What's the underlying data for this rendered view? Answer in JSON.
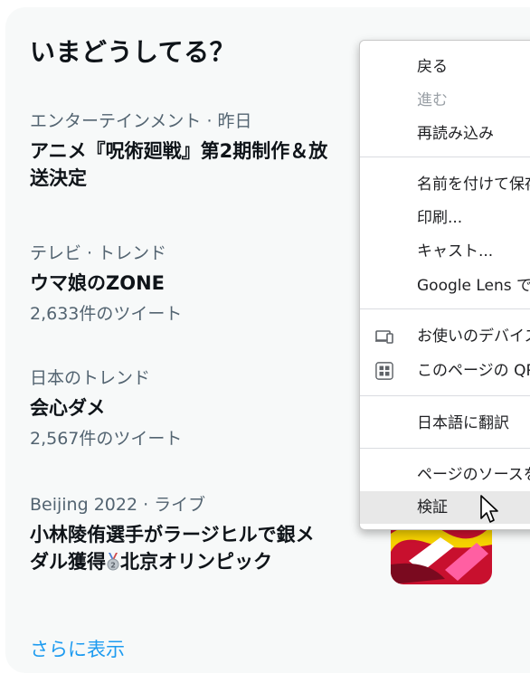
{
  "trends": {
    "title": "いまどうしてる？",
    "items": [
      {
        "meta": "エンターテインメント · 昨日",
        "name_line1": "アニメ『呪術廻戦』第2期制作＆放",
        "name_line2": "送決定"
      },
      {
        "meta": "テレビ · トレンド",
        "name": "ウマ娘のZONE",
        "count": "2,633件のツイート"
      },
      {
        "meta": "日本のトレンド",
        "name": "会心ダメ",
        "count": "2,567件のツイート"
      },
      {
        "meta": "Beijing 2022 · ライブ",
        "name_line1": "小林陵侑選手がラージヒルで銀メ",
        "name_line2_pre": "ダル獲得",
        "name_line2_post": "北京オリンピック"
      }
    ],
    "show_more": "さらに表示"
  },
  "context_menu": {
    "items": {
      "back": "戻る",
      "forward": "進む",
      "reload": "再読み込み",
      "save_as": "名前を付けて保存...",
      "print": "印刷...",
      "cast": "キャスト...",
      "lens": "Google Lens で画像を検索",
      "send_to_devices": "お使いのデバイスに送信",
      "qr_code": "このページの QR コードを作成",
      "translate": "日本語に翻訳",
      "view_source": "ページのソースを表示",
      "inspect": "検証"
    },
    "icons": {
      "send_to_devices": "devices-icon",
      "qr_code": "qr-code-icon"
    },
    "hovered": "inspect"
  },
  "colors": {
    "accent": "#1d9bf0",
    "card_bg": "#f7f9f9",
    "secondary_text": "#536471"
  }
}
